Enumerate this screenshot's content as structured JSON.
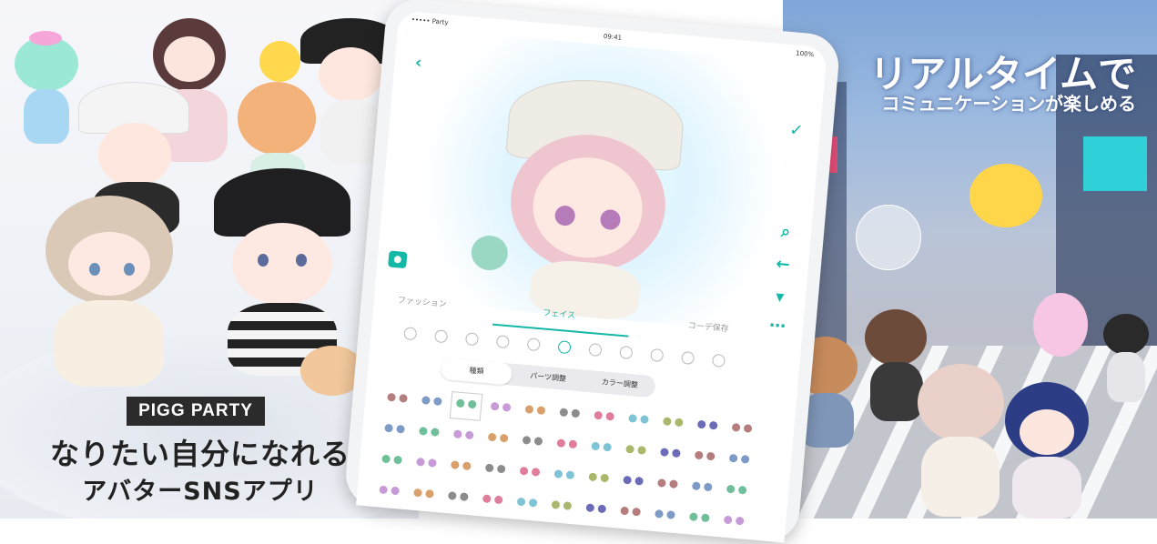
{
  "left_panel": {
    "brand_badge": "PIGG PARTY",
    "tagline_main": "なりたい自分になれる",
    "tagline_sub": "アバターSNSアプリ"
  },
  "tablet": {
    "status_bar": {
      "carrier": "••••• Party",
      "time": "09:41",
      "battery": "100%"
    },
    "tabs": [
      {
        "label": "ファッション",
        "active": false
      },
      {
        "label": "フェイス",
        "active": true
      },
      {
        "label": "コーデ保存",
        "active": false
      }
    ],
    "segmented": [
      {
        "label": "種類",
        "active": true
      },
      {
        "label": "パーツ調整",
        "active": false
      },
      {
        "label": "カラー調整",
        "active": false
      }
    ],
    "side_icons": [
      "search-icon",
      "back-arrow-icon",
      "clothes-icon",
      "more-icon"
    ],
    "colors": {
      "accent": "#14b8a6"
    }
  },
  "right_panel": {
    "headline_main": "リアルタイムで",
    "headline_sub": "コミュニケーションが楽しめる"
  }
}
